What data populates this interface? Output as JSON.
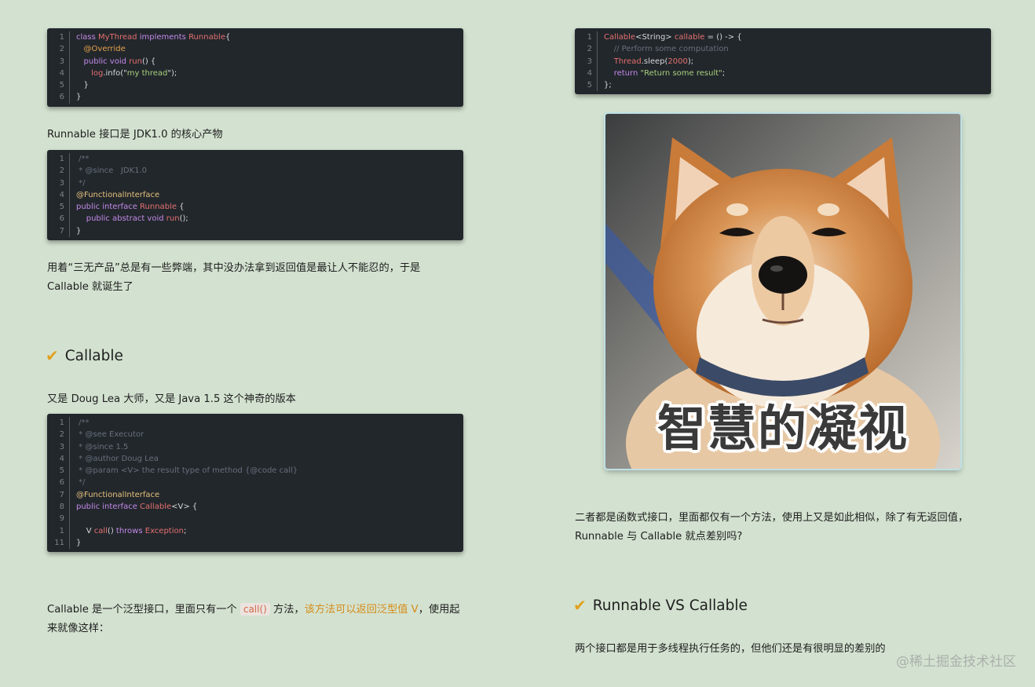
{
  "left": {
    "code1": [
      {
        "n": "1",
        "parts": [
          [
            "k",
            "class "
          ],
          [
            "r",
            "MyThread "
          ],
          [
            "k",
            "implements "
          ],
          [
            "r",
            "Runnable"
          ],
          [
            "",
            "{"
          ]
        ]
      },
      {
        "n": "2",
        "parts": [
          [
            "a",
            "   @Override"
          ]
        ]
      },
      {
        "n": "3",
        "parts": [
          [
            "k",
            "   public void "
          ],
          [
            "r",
            "run"
          ],
          [
            "",
            "() {"
          ]
        ]
      },
      {
        "n": "4",
        "parts": [
          [
            "r",
            "      log"
          ],
          [
            "",
            ".info(\""
          ],
          [
            "s",
            "my thread"
          ],
          [
            "",
            "\");"
          ]
        ]
      },
      {
        "n": "5",
        "parts": [
          [
            "",
            "   }"
          ]
        ]
      },
      {
        "n": "6",
        "parts": [
          [
            "",
            "}"
          ]
        ]
      }
    ],
    "p1": "Runnable 接口是 JDK1.0 的核心产物",
    "code2": [
      {
        "n": "1",
        "parts": [
          [
            "c",
            " /**"
          ]
        ]
      },
      {
        "n": "2",
        "parts": [
          [
            "c",
            " * @since   JDK1.0"
          ]
        ]
      },
      {
        "n": "3",
        "parts": [
          [
            "c",
            " */"
          ]
        ]
      },
      {
        "n": "4",
        "parts": [
          [
            "t",
            "@FunctionalInterface"
          ]
        ]
      },
      {
        "n": "5",
        "parts": [
          [
            "k",
            "public interface "
          ],
          [
            "r",
            "Runnable "
          ],
          [
            "",
            "{"
          ]
        ]
      },
      {
        "n": "6",
        "parts": [
          [
            "k",
            "    public abstract void "
          ],
          [
            "r",
            "run"
          ],
          [
            "",
            "();"
          ]
        ]
      },
      {
        "n": "7",
        "parts": [
          [
            "",
            "}"
          ]
        ]
      }
    ],
    "p2": "用着“三无产品”总是有一些弊端，其中没办法拿到返回值是最让人不能忍的，于是 Callable 就诞生了",
    "h1": "Callable",
    "p3": "又是 Doug Lea 大师，又是 Java 1.5 这个神奇的版本",
    "code3": [
      {
        "n": "1",
        "parts": [
          [
            "c",
            " /**"
          ]
        ]
      },
      {
        "n": "2",
        "parts": [
          [
            "c",
            " * @see Executor"
          ]
        ]
      },
      {
        "n": "3",
        "parts": [
          [
            "c",
            " * @since 1.5"
          ]
        ]
      },
      {
        "n": "4",
        "parts": [
          [
            "c",
            " * @author Doug Lea"
          ]
        ]
      },
      {
        "n": "5",
        "parts": [
          [
            "c",
            " * @param <V> the result type of method {@code call}"
          ]
        ]
      },
      {
        "n": "6",
        "parts": [
          [
            "c",
            " */"
          ]
        ]
      },
      {
        "n": "7",
        "parts": [
          [
            "t",
            "@FunctionalInterface"
          ]
        ]
      },
      {
        "n": "8",
        "parts": [
          [
            "k",
            "public interface "
          ],
          [
            "r",
            "Callable"
          ],
          [
            "",
            "<V> {"
          ]
        ]
      },
      {
        "n": "9",
        "parts": [
          [
            "",
            ""
          ]
        ]
      },
      {
        "n": "1",
        "parts": [
          [
            "",
            "    V "
          ],
          [
            "r",
            "call"
          ],
          [
            "",
            "() "
          ],
          [
            "k",
            "throws "
          ],
          [
            "r",
            "Exception"
          ],
          [
            "",
            ";"
          ]
        ]
      },
      {
        "n": "11",
        "parts": [
          [
            "",
            "}"
          ]
        ]
      }
    ],
    "p4a": "Callable 是一个泛型接口，里面只有一个 ",
    "p4code": "call()",
    "p4b": " 方法，",
    "p4hl": "该方法可以返回泛型值 V",
    "p4c": "，使用起来就像这样："
  },
  "right": {
    "code4": [
      {
        "n": "1",
        "parts": [
          [
            "r",
            "Callable"
          ],
          [
            "",
            "<String> "
          ],
          [
            "r",
            "callable "
          ],
          [
            "",
            "= () -> {"
          ]
        ]
      },
      {
        "n": "2",
        "parts": [
          [
            "c",
            "    // Perform some computation"
          ]
        ]
      },
      {
        "n": "3",
        "parts": [
          [
            "r",
            "    Thread"
          ],
          [
            "",
            ".sleep("
          ],
          [
            "r",
            "2000"
          ],
          [
            "",
            "); "
          ]
        ]
      },
      {
        "n": "4",
        "parts": [
          [
            "k",
            "    return "
          ],
          [
            "s",
            "\"Return some result\""
          ],
          [
            "",
            ";"
          ]
        ]
      },
      {
        "n": "5",
        "parts": [
          [
            "",
            "};"
          ]
        ]
      }
    ],
    "meme_text": "智慧的凝视",
    "p5": "二者都是函数式接口，里面都仅有一个方法，使用上又是如此相似，除了有无返回值，Runnable 与 Callable 就点差别吗?",
    "h2": "Runnable VS Callable",
    "p6": "两个接口都是用于多线程执行任务的，但他们还是有很明显的差别的"
  },
  "watermark": "@稀土掘金技术社区",
  "icons": {
    "heading": "checkmark-icon"
  }
}
